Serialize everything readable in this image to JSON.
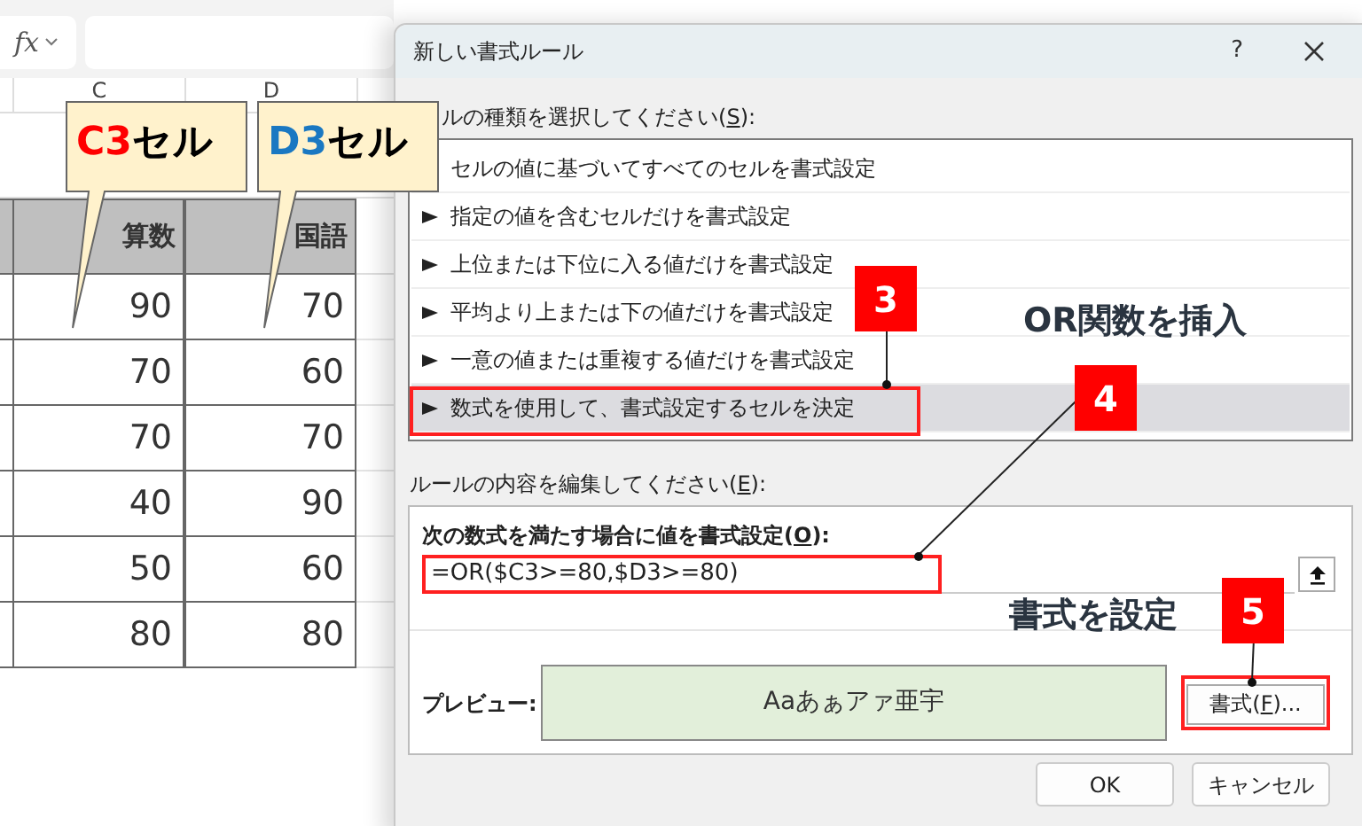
{
  "formula_bar": {
    "function_label": "fx"
  },
  "sheet": {
    "columns": [
      "C",
      "D"
    ],
    "headers": [
      "算数",
      "国語"
    ],
    "rows": [
      [
        "90",
        "70"
      ],
      [
        "70",
        "60"
      ],
      [
        "70",
        "70"
      ],
      [
        "40",
        "90"
      ],
      [
        "50",
        "60"
      ],
      [
        "80",
        "80"
      ]
    ]
  },
  "callouts": [
    {
      "ref": "C3",
      "color": "#ff0000",
      "suffix": "セル"
    },
    {
      "ref": "D3",
      "color": "#1a78c2",
      "suffix": "セル"
    }
  ],
  "dialog": {
    "title": "新しい書式ルール",
    "help": "?",
    "rule_type_label": {
      "before": "ルの種類を選択してください(",
      "key": "S",
      "after": "):"
    },
    "rule_types": [
      {
        "label": "セルの値に基づいてすべてのセルを書式設定",
        "selected": false,
        "marker_hidden": true
      },
      {
        "label": "指定の値を含むセルだけを書式設定",
        "selected": false
      },
      {
        "label": "上位または下位に入る値だけを書式設定",
        "selected": false
      },
      {
        "label": "平均より上または下の値だけを書式設定",
        "selected": false
      },
      {
        "label": "一意の値または重複する値だけを書式設定",
        "selected": false
      },
      {
        "label": "数式を使用して、書式設定するセルを決定",
        "selected": true
      }
    ],
    "edit_label": {
      "before": "ルールの内容を編集してください(",
      "key": "E",
      "after": "):"
    },
    "formula_label": {
      "before": "次の数式を満たす場合に値を書式設定(",
      "key": "O",
      "after": "):"
    },
    "formula": "=OR($C3>=80,$D3>=80)",
    "preview_label": "プレビュー:",
    "preview_text": "Aaあぁアァ亜宇",
    "format_button": {
      "before": "書式(",
      "key": "F",
      "after": ")..."
    },
    "buttons": [
      "OK",
      "キャンセル"
    ]
  },
  "steps": [
    {
      "number": "3"
    },
    {
      "number": "4",
      "note": "OR関数を挿入"
    },
    {
      "number": "5",
      "note": "書式を設定"
    }
  ]
}
